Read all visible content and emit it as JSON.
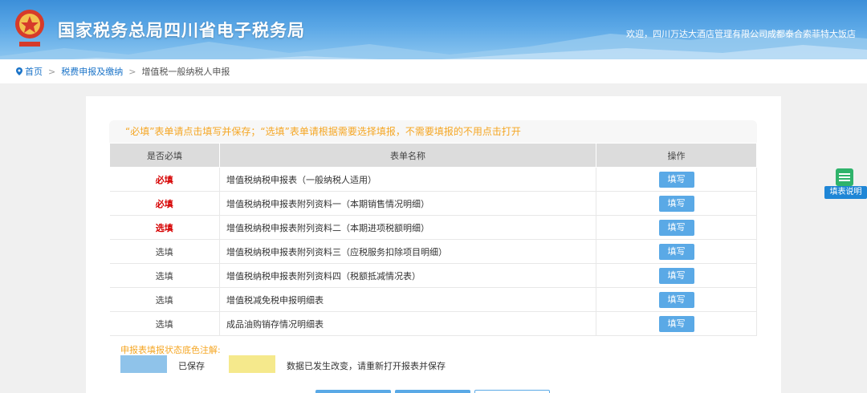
{
  "header": {
    "title": "国家税务总局四川省电子税务局",
    "welcome": "欢迎，四川万达大酒店管理有限公司成都泰合索菲特大饭店"
  },
  "breadcrumb": {
    "home": "首页",
    "level1": "税费申报及缴纳",
    "current": "增值税一般纳税人申报"
  },
  "notice": "“必填”表单请点击填写并保存；“选填”表单请根据需要选择填报，不需要填报的不用点击打开",
  "table": {
    "headers": [
      "是否必填",
      "表单名称",
      "操作"
    ],
    "rows": [
      {
        "req": "必填",
        "req_style": "must",
        "name": "增值税纳税申报表（一般纳税人适用）",
        "action": "填写"
      },
      {
        "req": "必填",
        "req_style": "must",
        "name": "增值税纳税申报表附列资料一（本期销售情况明细）",
        "action": "填写"
      },
      {
        "req": "选填",
        "req_style": "redopt",
        "name": "增值税纳税申报表附列资料二（本期进项税额明细）",
        "action": "填写"
      },
      {
        "req": "选填",
        "req_style": "opt",
        "name": "增值税纳税申报表附列资料三（应税服务扣除项目明细）",
        "action": "填写"
      },
      {
        "req": "选填",
        "req_style": "opt",
        "name": "增值税纳税申报表附列资料四（税额抵减情况表）",
        "action": "填写"
      },
      {
        "req": "选填",
        "req_style": "opt",
        "name": "增值税减免税申报明细表",
        "action": "填写"
      },
      {
        "req": "选填",
        "req_style": "opt",
        "name": "成品油购销存情况明细表",
        "action": "填写"
      }
    ]
  },
  "legend": {
    "title": "申报表填报状态底色注解:",
    "saved": "已保存",
    "changed": "数据已发生改变，请重新打开报表并保存",
    "saved_color": "#8fc3ea",
    "changed_color": "#f5e98c"
  },
  "help_label": "填表说明"
}
